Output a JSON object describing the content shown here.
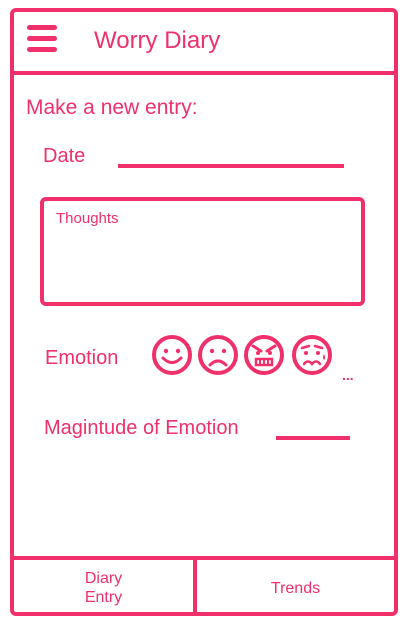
{
  "header": {
    "title": "Worry Diary",
    "menu_icon": "hamburger-menu-icon"
  },
  "entry_form": {
    "section_title": "Make a new entry:",
    "date_label": "Date",
    "date_value": "",
    "thoughts_placeholder": "Thoughts",
    "emotion_label": "Emotion",
    "emotions": [
      {
        "icon": "happy-face-icon"
      },
      {
        "icon": "sad-face-icon"
      },
      {
        "icon": "angry-face-icon"
      },
      {
        "icon": "anxious-face-icon"
      }
    ],
    "more_emotions": "...",
    "magnitude_label": "Magintude of Emotion",
    "magnitude_value": ""
  },
  "tab_bar": {
    "tabs": [
      {
        "label_line1": "Diary",
        "label_line2": "Entry"
      },
      {
        "label": "Trends"
      }
    ]
  },
  "colors": {
    "accent": "#f0306a",
    "background": "#ffffff"
  }
}
